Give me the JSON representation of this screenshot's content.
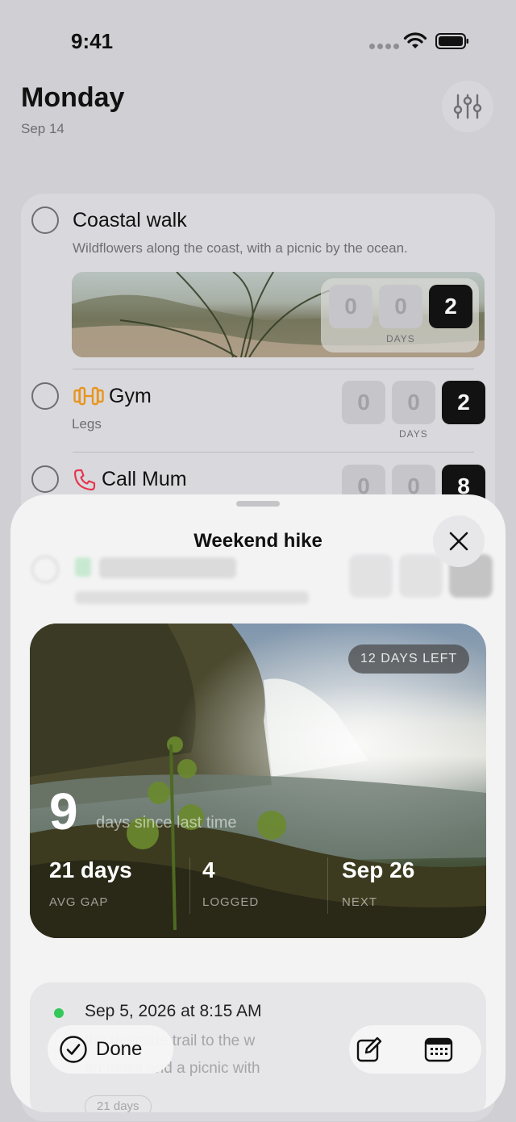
{
  "status_bar": {
    "time": "9:41"
  },
  "header": {
    "title": "Monday",
    "date": "Sep 14"
  },
  "list": {
    "items": [
      {
        "title": "Coastal walk",
        "subtitle": "Wildflowers along the coast, with a picnic by the ocean.",
        "counter": [
          "0",
          "0",
          "2"
        ],
        "counter_caption": "DAYS"
      },
      {
        "title": "Gym",
        "subtitle": "Legs",
        "counter": [
          "0",
          "0",
          "2"
        ],
        "counter_caption": "DAYS"
      },
      {
        "title": "Call Mum",
        "counter": [
          "0",
          "0",
          "8"
        ]
      }
    ]
  },
  "sheet": {
    "title": "Weekend hike",
    "badge": "12 DAYS LEFT",
    "since_value": "9",
    "since_label": "days since last time",
    "stats": [
      {
        "value": "21 days",
        "label": "AVG GAP"
      },
      {
        "value": "4",
        "label": "LOGGED"
      },
      {
        "value": "Sep 26",
        "label": "NEXT"
      }
    ],
    "log": {
      "date": "Sep 5, 2026 at 8:15 AM",
      "line1": "the riverside trail to the w",
      "line2": "en moss and a picnic with",
      "chip": "21 days",
      "status_color": "#34c759"
    },
    "actions": {
      "done_label": "Done"
    }
  },
  "colors": {
    "accent_gym": "#e8951f",
    "accent_call": "#e5364d",
    "counter_dark": "#121212"
  }
}
